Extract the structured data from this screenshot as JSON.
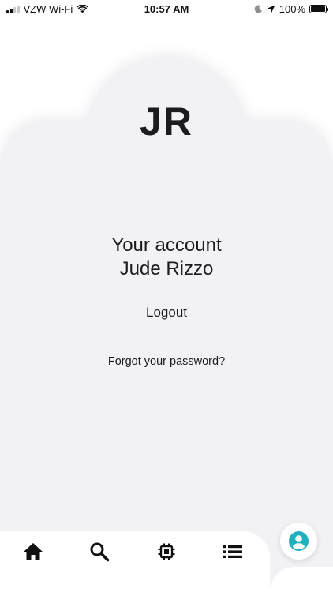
{
  "status_bar": {
    "carrier": "VZW Wi-Fi",
    "time": "10:57 AM",
    "battery": "100%"
  },
  "account": {
    "initials": "JR",
    "heading": "Your account",
    "user_name": "Jude Rizzo",
    "logout_label": "Logout",
    "forgot_password_label": "Forgot your password?"
  },
  "tab_bar": {
    "tabs": [
      {
        "icon": "home-icon"
      },
      {
        "icon": "search-icon"
      },
      {
        "icon": "chip-icon"
      },
      {
        "icon": "list-icon"
      }
    ],
    "profile_icon": "account-circle-icon"
  },
  "colors": {
    "card_background": "#f2f2f4",
    "text": "#1c1c1e",
    "accent": "#1fb2be"
  }
}
